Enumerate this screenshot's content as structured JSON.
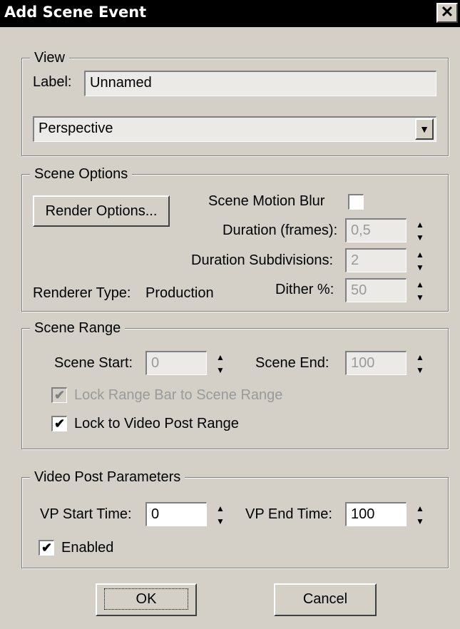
{
  "dialog": {
    "title": "Add Scene Event",
    "close_glyph": "✕"
  },
  "view": {
    "legend": "View",
    "label_caption": "Label:",
    "label_value": "Unnamed",
    "viewport_selected": "Perspective"
  },
  "scene_options": {
    "legend": "Scene Options",
    "render_options_button": "Render Options...",
    "motion_blur_label": "Scene Motion Blur",
    "motion_blur_checked": false,
    "duration_label": "Duration (frames):",
    "duration_value": "0,5",
    "subdivisions_label": "Duration Subdivisions:",
    "subdivisions_value": "2",
    "renderer_type_label": "Renderer Type:",
    "renderer_type_value": "Production",
    "dither_label": "Dither %:",
    "dither_value": "50"
  },
  "scene_range": {
    "legend": "Scene Range",
    "start_label": "Scene Start:",
    "start_value": "0",
    "end_label": "Scene End:",
    "end_value": "100",
    "lock_range_bar_label": "Lock Range Bar to Scene Range",
    "lock_range_bar_checked": true,
    "lock_video_post_label": "Lock to Video Post Range",
    "lock_video_post_checked": true
  },
  "video_post": {
    "legend": "Video Post Parameters",
    "vp_start_label": "VP Start Time:",
    "vp_start_value": "0",
    "vp_end_label": "VP End Time:",
    "vp_end_value": "100",
    "enabled_label": "Enabled",
    "enabled_checked": true
  },
  "buttons": {
    "ok": "OK",
    "cancel": "Cancel"
  },
  "glyphs": {
    "check": "✔",
    "spin_up": "▲",
    "spin_down": "▼",
    "dropdown": "▼"
  }
}
